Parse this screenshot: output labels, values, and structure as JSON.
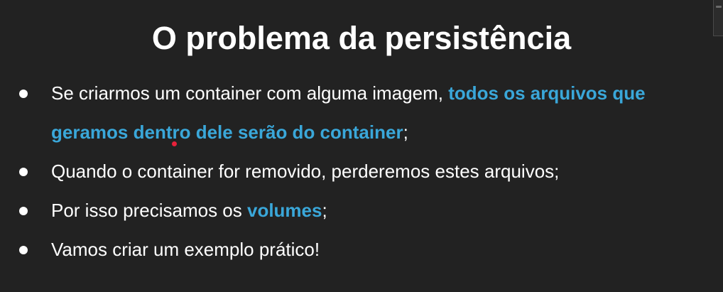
{
  "slide": {
    "title": "O problema da persistência",
    "bullets": [
      {
        "text_before": "Se criarmos um container com alguma imagem, ",
        "highlight": "todos os arquivos que geramos dentro dele serão do container",
        "text_after": ";"
      },
      {
        "text": "Quando o container for removido, perderemos estes arquivos;"
      },
      {
        "text_before": "Por isso precisamos os ",
        "highlight": "volumes",
        "text_after": ";"
      },
      {
        "text": "Vamos criar um exemplo prático!"
      }
    ]
  },
  "colors": {
    "background": "#222222",
    "text": "#ffffff",
    "highlight": "#3aa7d9",
    "pointer": "#e8213a"
  }
}
